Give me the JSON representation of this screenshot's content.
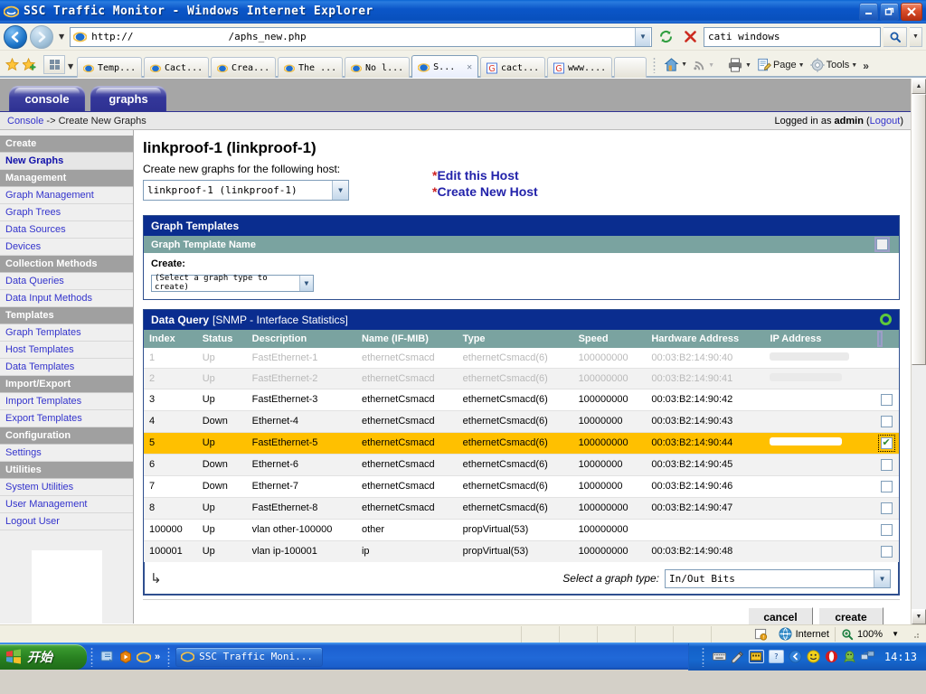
{
  "window": {
    "title": "SSC Traffic Monitor - Windows Internet Explorer",
    "minimize_label": "0",
    "restore_label": "❐",
    "close_label": "✕"
  },
  "address_bar": {
    "url_prefix": "http://",
    "url_suffix": "/aphs_new.php",
    "url_redacted": true,
    "back_label": "←",
    "forward_label": "→",
    "history_caret": "▼",
    "dropdown_caret": "▼",
    "refresh_label": "↻",
    "stop_label": "✕",
    "search_value": "cati windows",
    "search_go_label": "⚲",
    "search_caret": "▼"
  },
  "tab_bar": {
    "favorites_label": "★",
    "add_favorite_label": "➕",
    "quick_tabs_label": "Quick Tabs",
    "quick_tabs_caret": "▼",
    "tabs": [
      {
        "label": "Temp...",
        "icon": "ie-icon",
        "active": false
      },
      {
        "label": "Cact...",
        "icon": "ie-icon",
        "active": false
      },
      {
        "label": "Crea...",
        "icon": "ie-icon",
        "active": false
      },
      {
        "label": "The ...",
        "icon": "ie-icon",
        "active": false
      },
      {
        "label": "No l...",
        "icon": "ie-icon",
        "active": false
      },
      {
        "label": "S...",
        "icon": "ie-icon",
        "active": true,
        "close_label": "✕"
      },
      {
        "label": "cact...",
        "icon": "google-icon",
        "active": false
      },
      {
        "label": "www....",
        "icon": "google-icon",
        "active": false
      }
    ],
    "toolbar": {
      "home_label": "Home",
      "home_caret": "▼",
      "feeds_label": "Feeds",
      "feeds_caret": "▼",
      "print_label": "Print",
      "print_caret": "▼",
      "page_label": "Page",
      "page_caret": "▼",
      "tools_label": "Tools",
      "tools_caret": "▼",
      "overflow_label": "»"
    }
  },
  "cacti": {
    "tabs": [
      {
        "label": "console",
        "active": true
      },
      {
        "label": "graphs",
        "active": false
      }
    ],
    "breadcrumb": {
      "console_label": "Console",
      "separator": "->",
      "current": "Create New Graphs"
    },
    "login_status": {
      "prefix": "Logged in as",
      "user": "admin",
      "logout_open": "(",
      "logout_label": "Logout",
      "logout_close": ")"
    },
    "sidebar": {
      "sections": [
        {
          "header": "Create",
          "items": [
            {
              "label": "New Graphs",
              "selected": true
            }
          ]
        },
        {
          "header": "Management",
          "items": [
            {
              "label": "Graph Management",
              "selected": false
            },
            {
              "label": "Graph Trees",
              "selected": false
            },
            {
              "label": "Data Sources",
              "selected": false
            },
            {
              "label": "Devices",
              "selected": false
            }
          ]
        },
        {
          "header": "Collection Methods",
          "items": [
            {
              "label": "Data Queries",
              "selected": false
            },
            {
              "label": "Data Input Methods",
              "selected": false
            }
          ]
        },
        {
          "header": "Templates",
          "items": [
            {
              "label": "Graph Templates",
              "selected": false
            },
            {
              "label": "Host Templates",
              "selected": false
            },
            {
              "label": "Data Templates",
              "selected": false
            }
          ]
        },
        {
          "header": "Import/Export",
          "items": [
            {
              "label": "Import Templates",
              "selected": false
            },
            {
              "label": "Export Templates",
              "selected": false
            }
          ]
        },
        {
          "header": "Configuration",
          "items": [
            {
              "label": "Settings",
              "selected": false
            }
          ]
        },
        {
          "header": "Utilities",
          "items": [
            {
              "label": "System Utilities",
              "selected": false
            },
            {
              "label": "User Management",
              "selected": false
            },
            {
              "label": "Logout User",
              "selected": false
            }
          ]
        }
      ]
    },
    "main": {
      "host_title": "linkproof-1 (linkproof-1)",
      "intro_text": "Create new graphs for the following host:",
      "host_select_value": "linkproof-1 (linkproof-1)",
      "host_select_caret": "▼",
      "actions": [
        {
          "asterisk": "*",
          "label": "Edit this Host"
        },
        {
          "asterisk": "*",
          "label": "Create New Host"
        }
      ],
      "graph_templates_panel": {
        "title": "Graph Templates",
        "column_header": "Graph Template Name",
        "create_label": "Create:",
        "create_select_value": "(Select a graph type to create)",
        "create_select_caret": "▼"
      },
      "data_query_panel": {
        "title": "Data Query",
        "subtitle": "[SNMP - Interface Statistics]",
        "refresh_icon": "refresh-icon",
        "columns": [
          "Index",
          "Status",
          "Description",
          "Name (IF-MIB)",
          "Type",
          "Speed",
          "Hardware Address",
          "IP Address"
        ],
        "rows": [
          {
            "index": "1",
            "status": "Up",
            "description": "FastEthernet-1",
            "name": "ethernetCsmacd",
            "type": "ethernetCsmacd(6)",
            "speed": "100000000",
            "hw": "00:03:B2:14:90:40",
            "ip": "",
            "ip_redacted": true,
            "disabled": true,
            "checked": false,
            "selected": false
          },
          {
            "index": "2",
            "status": "Up",
            "description": "FastEthernet-2",
            "name": "ethernetCsmacd",
            "type": "ethernetCsmacd(6)",
            "speed": "100000000",
            "hw": "00:03:B2:14:90:41",
            "ip": "",
            "ip_redacted": true,
            "disabled": true,
            "checked": false,
            "selected": false
          },
          {
            "index": "3",
            "status": "Up",
            "description": "FastEthernet-3",
            "name": "ethernetCsmacd",
            "type": "ethernetCsmacd(6)",
            "speed": "100000000",
            "hw": "00:03:B2:14:90:42",
            "ip": "",
            "ip_redacted": true,
            "disabled": false,
            "checked": false,
            "selected": false
          },
          {
            "index": "4",
            "status": "Down",
            "description": "Ethernet-4",
            "name": "ethernetCsmacd",
            "type": "ethernetCsmacd(6)",
            "speed": "10000000",
            "hw": "00:03:B2:14:90:43",
            "ip": "",
            "ip_redacted": false,
            "disabled": false,
            "checked": false,
            "selected": false
          },
          {
            "index": "5",
            "status": "Up",
            "description": "FastEthernet-5",
            "name": "ethernetCsmacd",
            "type": "ethernetCsmacd(6)",
            "speed": "100000000",
            "hw": "00:03:B2:14:90:44",
            "ip": "",
            "ip_redacted": true,
            "disabled": false,
            "checked": true,
            "selected": true
          },
          {
            "index": "6",
            "status": "Down",
            "description": "Ethernet-6",
            "name": "ethernetCsmacd",
            "type": "ethernetCsmacd(6)",
            "speed": "10000000",
            "hw": "00:03:B2:14:90:45",
            "ip": "",
            "ip_redacted": false,
            "disabled": false,
            "checked": false,
            "selected": false
          },
          {
            "index": "7",
            "status": "Down",
            "description": "Ethernet-7",
            "name": "ethernetCsmacd",
            "type": "ethernetCsmacd(6)",
            "speed": "10000000",
            "hw": "00:03:B2:14:90:46",
            "ip": "",
            "ip_redacted": false,
            "disabled": false,
            "checked": false,
            "selected": false
          },
          {
            "index": "8",
            "status": "Up",
            "description": "FastEthernet-8",
            "name": "ethernetCsmacd",
            "type": "ethernetCsmacd(6)",
            "speed": "100000000",
            "hw": "00:03:B2:14:90:47",
            "ip": "",
            "ip_redacted": false,
            "disabled": false,
            "checked": false,
            "selected": false
          },
          {
            "index": "100000",
            "status": "Up",
            "description": "vlan other-100000",
            "name": "other",
            "type": "propVirtual(53)",
            "speed": "100000000",
            "hw": "",
            "ip": "",
            "ip_redacted": false,
            "disabled": false,
            "checked": false,
            "selected": false
          },
          {
            "index": "100001",
            "status": "Up",
            "description": "vlan ip-100001",
            "name": "ip",
            "type": "propVirtual(53)",
            "speed": "100000000",
            "hw": "00:03:B2:14:90:48",
            "ip": "",
            "ip_redacted": false,
            "disabled": false,
            "checked": false,
            "selected": false
          }
        ],
        "footer": {
          "return_arrow": "↳",
          "graph_type_label": "Select a graph type:",
          "graph_type_value": "In/Out Bits",
          "graph_type_caret": "▼"
        }
      },
      "buttons": {
        "cancel_label": "cancel",
        "create_label": "create"
      }
    }
  },
  "scrollbar": {
    "up_label": "▲",
    "down_label": "▼"
  },
  "status_bar": {
    "zone_icon": "internet-zone-icon",
    "zone_label": "Internet",
    "zoom_icon": "zoom-icon",
    "zoom_level": "100%",
    "zoom_caret": "▼"
  },
  "taskbar": {
    "start_label": "开始",
    "quick_launch": [
      {
        "name": "show-desktop-icon"
      },
      {
        "name": "media-player-icon"
      },
      {
        "name": "ie-icon"
      }
    ],
    "quick_launch_overflow": "»",
    "task_items": [
      {
        "label": "SSC Traffic Moni...",
        "icon": "ie-icon",
        "active": true
      }
    ],
    "tray_icons": [
      {
        "name": "keyboard-icon"
      },
      {
        "name": "handwriting-icon"
      },
      {
        "name": "ime-toolbar-icon"
      },
      {
        "name": "ime-help-icon"
      },
      {
        "name": "tray-expand-icon"
      },
      {
        "name": "msn-messenger-icon"
      },
      {
        "name": "opera-icon"
      },
      {
        "name": "qq-icon"
      },
      {
        "name": "network-icon"
      }
    ],
    "clock": "14:13"
  },
  "colors": {
    "titlebar_blue": "#0b56c8",
    "cacti_panel_blue": "#0a2d8f",
    "cacti_subhead_teal": "#7aa3a0",
    "selected_row_gold": "#ffc000",
    "link_blue": "#3333cc",
    "sidebar_header_gray": "#a0a0a0",
    "taskbar_blue": "#1b5fd0",
    "start_green": "#288020"
  }
}
